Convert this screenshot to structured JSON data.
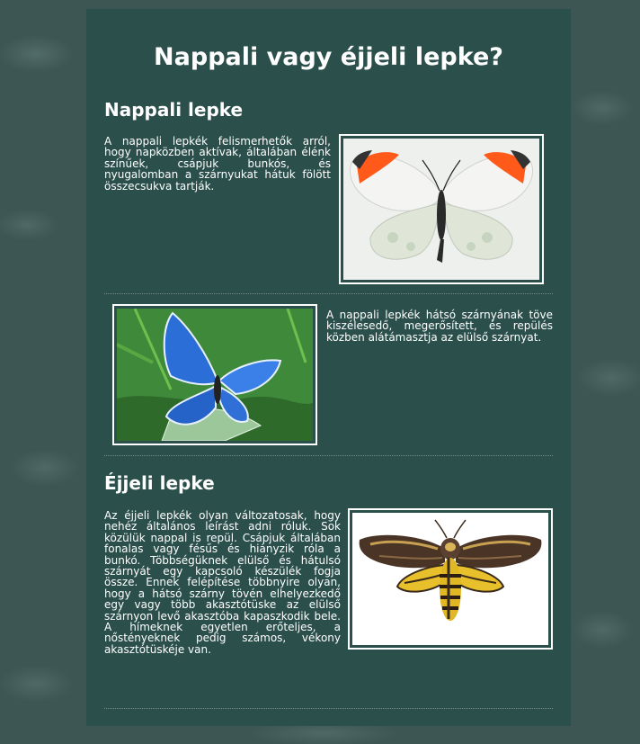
{
  "page": {
    "title": "Nappali vagy éjjeli lepke?"
  },
  "day_section": {
    "heading": "Nappali lepke",
    "paragraph1": "A nappali lepkék felismerhetők arról, hogy napközben aktívak, általában élénk színűek, csápjuk bunkós, és nyugalomban a szárnyukat hátuk fölött összecsukva tartják.",
    "paragraph2": "A nappali lepkék hátsó szárnyának töve kiszélesedő, megerősített, és repülés közben alátámasztja az elülső szárnyat."
  },
  "night_section": {
    "heading": "Éjjeli lepke",
    "paragraph": "Az éjjeli lepkék olyan változatosak, hogy nehéz általános leírást adni róluk. Sok közülük nappal is repül. Csápjuk általában fonalas vagy fésűs és hiányzik róla a bunkó. Többségüknek elülső és hátulsó szárnyát egy kapcsoló készülék fogja össze. Ennek felépítése többnyire olyan, hogy a hátsó szárny tövén elhelyezkedő egy vagy több akasztótüske az elülső szárnyon levő akasztóba kapaszkodik bele. A hímeknek egyetlen erőteljes, a nőstényeknek pedig számos, vékony akasztótüskéje van."
  },
  "colors": {
    "panel": "#2b4f4b",
    "background": "#3d5553",
    "text": "#ffffff"
  }
}
